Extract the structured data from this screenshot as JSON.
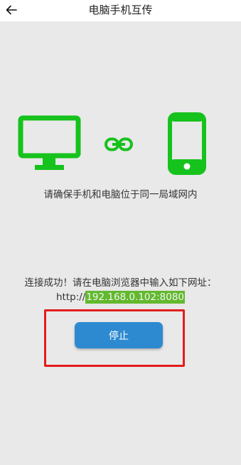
{
  "header": {
    "title": "电脑手机互传",
    "back_icon": "arrow-left-icon"
  },
  "connection": {
    "hint": "请确保手机和电脑位于同一局域网内",
    "success_message": "连接成功！请在电脑浏览器中输入如下网址：",
    "url_prefix": "http://",
    "url_address": "192.168.0.102:8080",
    "stop_label": "停止"
  },
  "icons": {
    "monitor": "monitor-icon",
    "link": "link-icon",
    "phone": "smartphone-icon"
  },
  "colors": {
    "accent_green": "#16c21c",
    "button_blue": "#2e8ad0",
    "highlight_red": "#e31c1c",
    "url_highlight": "#62b92d"
  }
}
